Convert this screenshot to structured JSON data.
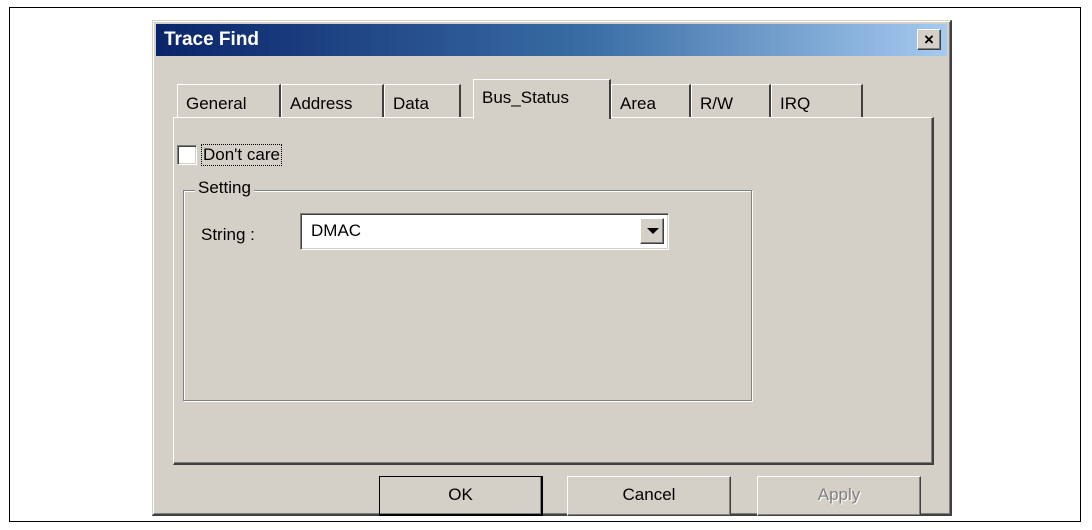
{
  "window": {
    "title": "Trace Find",
    "close_glyph": "×"
  },
  "tabs": [
    {
      "label": "General",
      "active": false
    },
    {
      "label": "Address",
      "active": false
    },
    {
      "label": "Data",
      "active": false
    },
    {
      "label": "Bus_Status",
      "active": true
    },
    {
      "label": "Area",
      "active": false
    },
    {
      "label": "R/W",
      "active": false
    },
    {
      "label": "IRQ",
      "active": false
    }
  ],
  "dont_care": {
    "label": "Don't care",
    "checked": false
  },
  "setting_group": {
    "label": "Setting",
    "string_label": "String :",
    "string_value": "DMAC"
  },
  "buttons": {
    "ok": "OK",
    "cancel": "Cancel",
    "apply": "Apply",
    "apply_enabled": false
  },
  "colors": {
    "dialog_face": "#d4d0c8",
    "title_start": "#0a246a",
    "title_end": "#a6caf0"
  }
}
